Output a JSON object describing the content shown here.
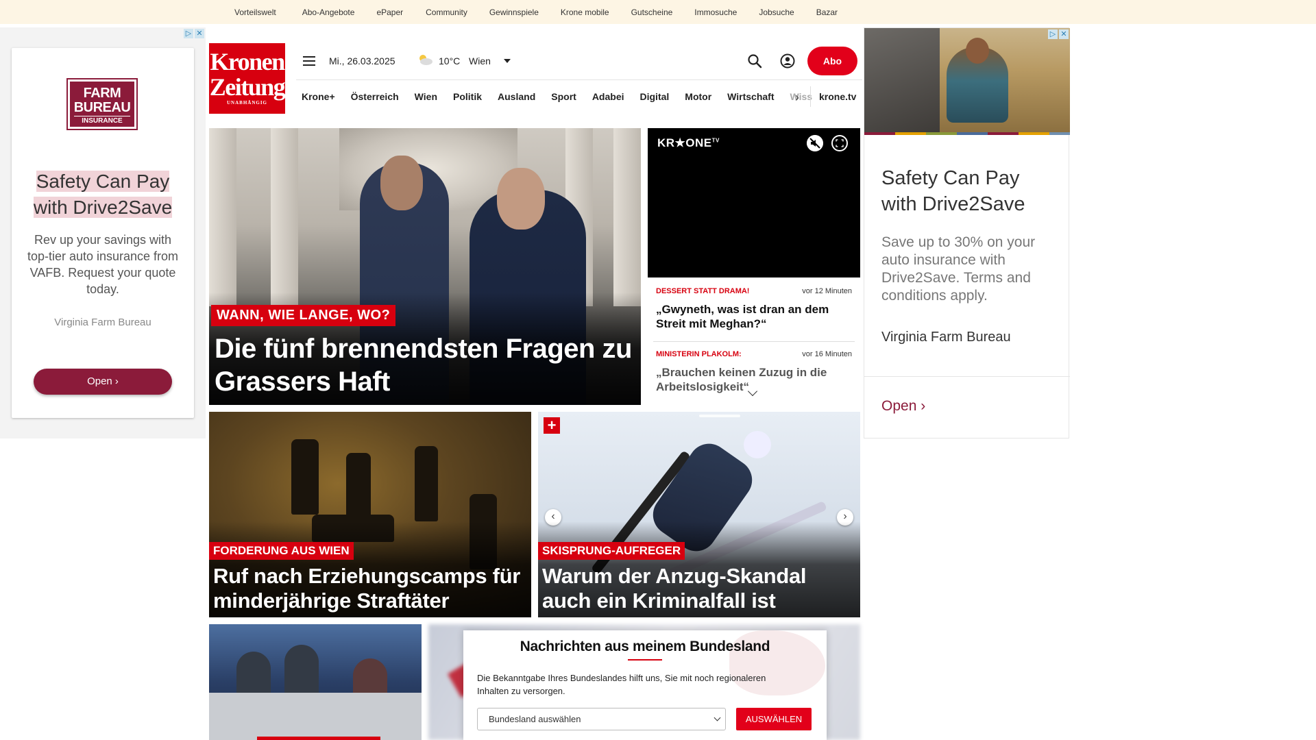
{
  "topnav": [
    "Vorteilswelt",
    "Abo-Angebote",
    "ePaper",
    "Community",
    "Gewinnspiele",
    "Krone mobile",
    "Gutscheine",
    "Immosuche",
    "Jobsuche",
    "Bazar"
  ],
  "ad_left": {
    "logo": [
      "FARM",
      "BUREAU",
      "INSURANCE"
    ],
    "headline": "Safety Can Pay with Drive2Save",
    "body": "Rev up your savings with top-tier auto insurance from VAFB. Request your quote today.",
    "advertiser": "Virginia Farm Bureau",
    "button": "Open ›"
  },
  "ad_right": {
    "headline": "Safety Can Pay with Drive2Save",
    "body": "Save up to 30% on your auto insurance with Drive2Save. Terms and conditions apply.",
    "advertiser": "Virginia Farm Bureau",
    "button": "Open ›"
  },
  "header": {
    "logo_line1": "Kronen",
    "logo_line2": "Zeitung",
    "logo_tag": "UNABHÄNGIG",
    "date": "Mi., 26.03.2025",
    "temperature": "10°C",
    "city": "Wien",
    "abo": "Abo"
  },
  "nav": [
    "Krone+",
    "Österreich",
    "Wien",
    "Politik",
    "Ausland",
    "Sport",
    "Adabei",
    "Digital",
    "Motor",
    "Wirtschaft"
  ],
  "nav_cut": "Wiss",
  "nav_tv": "krone.tv",
  "hero": {
    "kicker": "WANN, WIE LANGE, WO?",
    "headline": "Die fünf brennendsten Fragen zu Grassers Haft"
  },
  "video": {
    "brand": "KR★ONE",
    "brand_sup": "TV"
  },
  "news": [
    {
      "kicker": "DESSERT STATT DRAMA!",
      "time": "vor 12 Minuten",
      "title": "„Gwyneth, was ist dran an dem Streit mit Meghan?“"
    },
    {
      "kicker": "MINISTERIN PLAKOLM:",
      "time": "vor 16 Minuten",
      "title": "„Brauchen keinen Zuzug in die Arbeitslosigkeit“"
    }
  ],
  "tiles": [
    {
      "kicker": "FORDERUNG AUS WIEN",
      "headline": "Ruf nach Erziehungscamps für minderjährige Straftäter"
    },
    {
      "kicker": "SKISPRUNG-AUFREGER",
      "headline": "Warum der Anzug-Skandal auch ein Kriminalfall ist"
    }
  ],
  "modal": {
    "title": "Nachrichten aus meinem Bundesland",
    "text": "Die Bekanntgabe Ihres Bundeslandes hilft uns, Sie mit noch regionaleren Inhalten zu versorgen.",
    "select": "Bundesland auswählen",
    "button": "AUSWÄHLEN"
  }
}
